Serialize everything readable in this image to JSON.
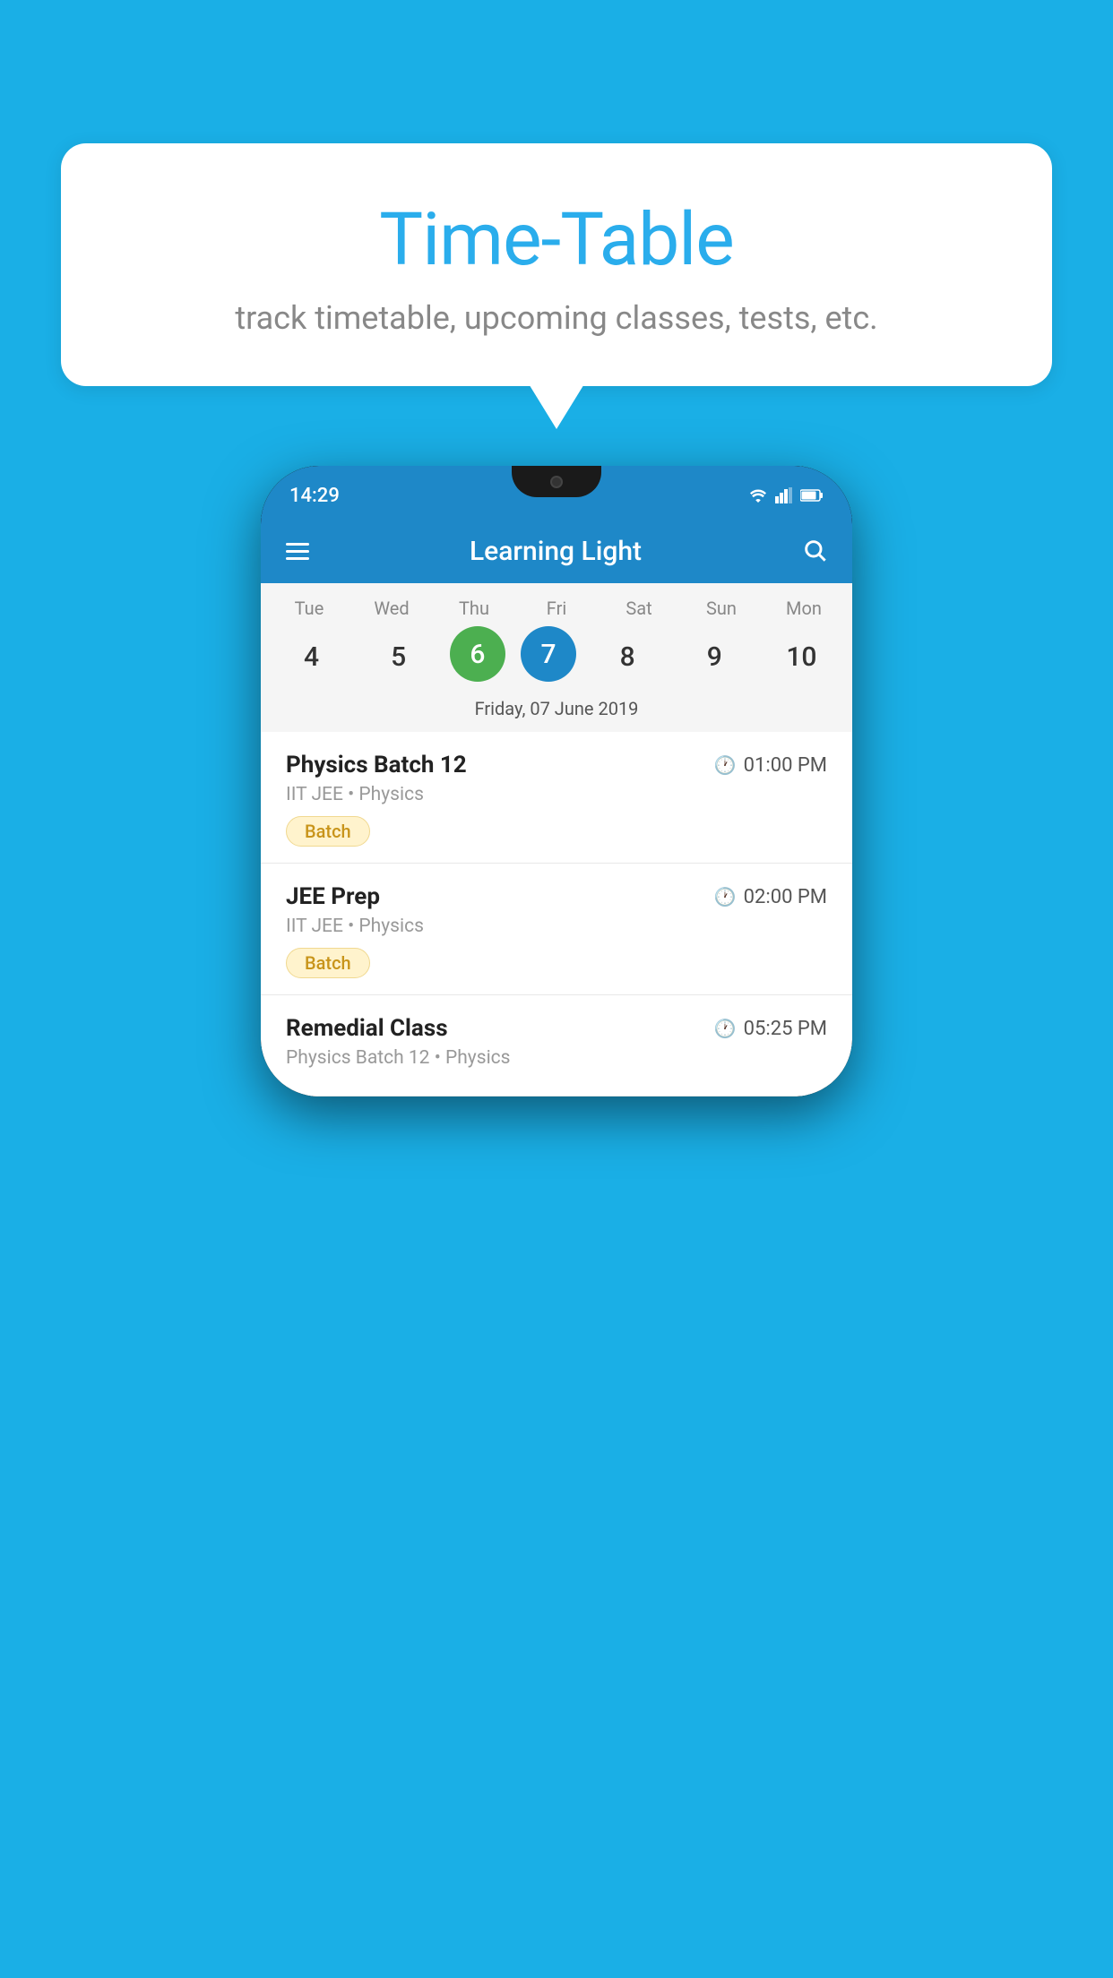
{
  "background_color": "#1AAFE6",
  "speech_bubble": {
    "title": "Time-Table",
    "subtitle": "track timetable, upcoming classes, tests, etc."
  },
  "phone": {
    "status_bar": {
      "time": "14:29"
    },
    "app_header": {
      "title": "Learning Light"
    },
    "calendar": {
      "days": [
        "Tue",
        "Wed",
        "Thu",
        "Fri",
        "Sat",
        "Sun",
        "Mon"
      ],
      "dates": [
        "4",
        "5",
        "6",
        "7",
        "8",
        "9",
        "10"
      ],
      "today_index": 2,
      "selected_index": 3,
      "selected_label": "Friday, 07 June 2019"
    },
    "classes": [
      {
        "name": "Physics Batch 12",
        "time": "01:00 PM",
        "meta": "IIT JEE • Physics",
        "badge": "Batch"
      },
      {
        "name": "JEE Prep",
        "time": "02:00 PM",
        "meta": "IIT JEE • Physics",
        "badge": "Batch"
      },
      {
        "name": "Remedial Class",
        "time": "05:25 PM",
        "meta": "Physics Batch 12 • Physics",
        "badge": null
      }
    ]
  }
}
